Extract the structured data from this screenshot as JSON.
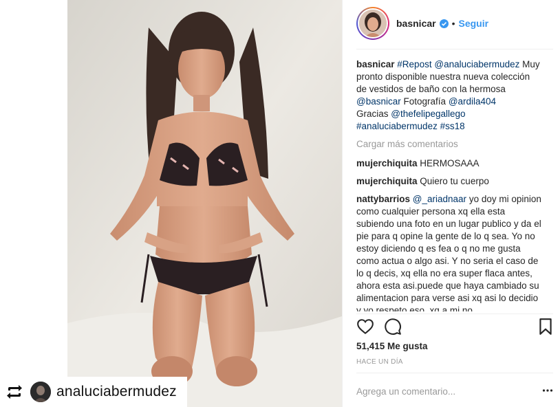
{
  "post": {
    "username": "basnicar",
    "follow_label": "Seguir",
    "separator": "•",
    "caption": {
      "username": "basnicar",
      "repost_tag": "#Repost",
      "repost_user": "@analuciabermudez",
      "text1": "Muy pronto disponible nuestra nueva colección de vestidos de baño con la hermosa",
      "mention1": "@basnicar",
      "text2": "Fotografía",
      "mention2": "@ardila404",
      "text3": "Gracias",
      "mention3": "@thefelipegallego",
      "hashtag1": "#analuciabermudez",
      "hashtag2": "#ss18"
    },
    "load_more": "Cargar más comentarios",
    "comments": [
      {
        "user": "mujerchiquita",
        "text": "HERMOSAAA"
      },
      {
        "user": "mujerchiquita",
        "text": "Quiero tu cuerpo"
      },
      {
        "user": "nattybarrios",
        "mention": "@_ariadnaar",
        "text": "yo doy mi opinion como cualquier persona xq ella esta subiendo una foto en un lugar publico y da el pie para q opine la gente de lo q sea. Yo no estoy diciendo q es fea o q no me gusta como actua o algo asi. Y no seria el caso de lo q decis, xq ella no era super flaca antes, ahora esta asi.puede que haya cambiado su alimentacion para verse asi xq asi lo decidio y yo respeto eso. xq a mi no"
      }
    ],
    "likes": "51,415 Me gusta",
    "timestamp": "HACE UN DÍA",
    "comment_placeholder": "Agrega un comentario...",
    "more_options": "•••"
  },
  "repost_badge": {
    "username": "analuciabermudez"
  },
  "icons": {
    "verified": "verified-badge-icon",
    "like": "heart-icon",
    "comment": "comment-bubble-icon",
    "save": "bookmark-icon",
    "repost": "repost-arrows-icon"
  },
  "colors": {
    "link": "#003569",
    "follow": "#3897f0",
    "muted": "#999999",
    "verified": "#3897f0"
  }
}
